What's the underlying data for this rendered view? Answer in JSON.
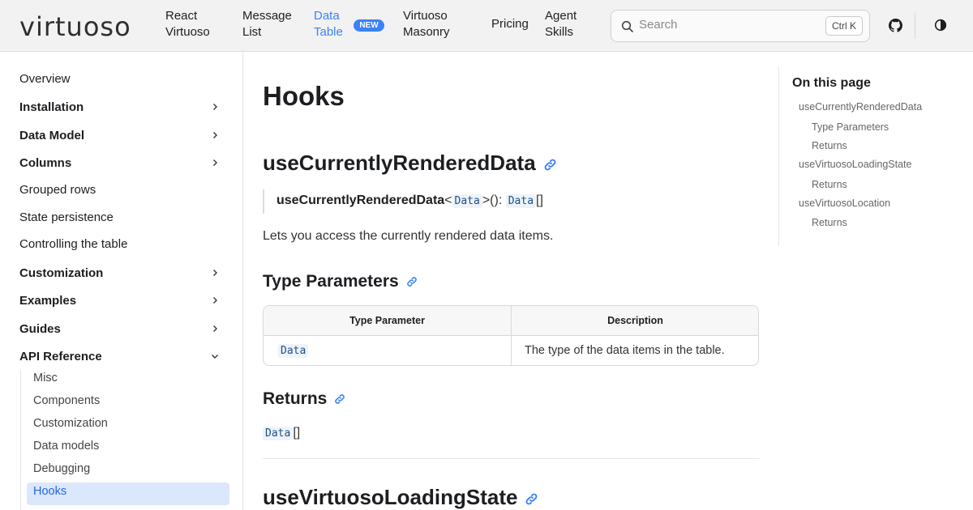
{
  "navbar": {
    "logo_text": "virtuoso",
    "items": [
      {
        "label": "React\nVirtuoso"
      },
      {
        "label": "Message\nList"
      },
      {
        "label": "Data\nTable"
      },
      {
        "label": "Virtuoso\nMasonry"
      },
      {
        "label": "Pricing"
      },
      {
        "label": "Agent\nSkills"
      }
    ],
    "new_badge": "NEW",
    "search": {
      "placeholder": "Search",
      "shortcut": "Ctrl K"
    },
    "icons": [
      "github-icon",
      "theme-toggle-icon",
      "search-icon"
    ],
    "active_color": "#3b82f6"
  },
  "sidebar": {
    "items": [
      {
        "label": "Overview"
      },
      {
        "label": "Installation"
      },
      {
        "label": "Data Model"
      },
      {
        "label": "Columns"
      },
      {
        "label": "Grouped rows"
      },
      {
        "label": "State persistence"
      },
      {
        "label": "Controlling the table"
      },
      {
        "label": "Customization"
      },
      {
        "label": "Examples"
      },
      {
        "label": "Guides"
      },
      {
        "label": "API Reference"
      }
    ],
    "sub_items": [
      {
        "label": "Misc"
      },
      {
        "label": "Components"
      },
      {
        "label": "Customization"
      },
      {
        "label": "Data models"
      },
      {
        "label": "Debugging"
      },
      {
        "label": "Hooks"
      }
    ]
  },
  "main": {
    "title": "Hooks",
    "section1": {
      "heading": "useCurrentlyRenderedData",
      "signature_name": "useCurrentlyRenderedData",
      "sig_lt": "<",
      "sig_type": "Data",
      "sig_gt": ">():",
      "sig_return": "Data",
      "sig_brackets": "[]",
      "description": "Lets you access the currently rendered data items.",
      "type_params_heading": "Type Parameters",
      "table": {
        "headers": [
          "Type Parameter",
          "Description"
        ],
        "rows": [
          [
            "Data",
            "The type of the data items in the table."
          ]
        ]
      },
      "returns_heading": "Returns",
      "returns_type": "Data",
      "returns_brackets": "[]"
    },
    "section2": {
      "heading": "useVirtuosoLoadingState"
    }
  },
  "toc": {
    "title": "On this page",
    "items": [
      {
        "label": "useCurrentlyRenderedData"
      },
      {
        "label": "Type Parameters"
      },
      {
        "label": "Returns"
      },
      {
        "label": "useVirtuosoLoadingState"
      },
      {
        "label": "Returns"
      },
      {
        "label": "useVirtuosoLocation"
      },
      {
        "label": "Returns"
      }
    ]
  }
}
